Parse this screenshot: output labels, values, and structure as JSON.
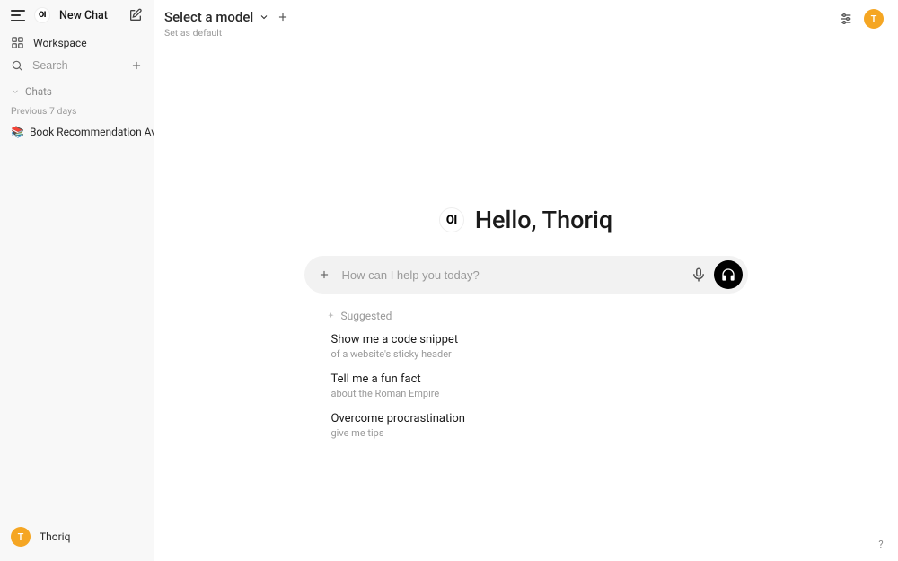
{
  "sidebar": {
    "logo_text": "OI",
    "new_chat": "New Chat",
    "workspace": "Workspace",
    "search_placeholder": "Search",
    "chats_label": "Chats",
    "time_group": "Previous 7 days",
    "chat": {
      "emoji": "📚",
      "title": "Book Recommendation Available"
    },
    "user": {
      "initial": "T",
      "name": "Thoriq"
    }
  },
  "topbar": {
    "model_label": "Select a model",
    "set_default": "Set as default",
    "avatar_initial": "T"
  },
  "greeting": {
    "logo_text": "OI",
    "text": "Hello, Thoriq"
  },
  "composer": {
    "placeholder": "How can I help you today?"
  },
  "suggestions": {
    "label": "Suggested",
    "items": [
      {
        "title": "Show me a code snippet",
        "sub": "of a website's sticky header"
      },
      {
        "title": "Tell me a fun fact",
        "sub": "about the Roman Empire"
      },
      {
        "title": "Overcome procrastination",
        "sub": "give me tips"
      }
    ]
  },
  "help": "?"
}
